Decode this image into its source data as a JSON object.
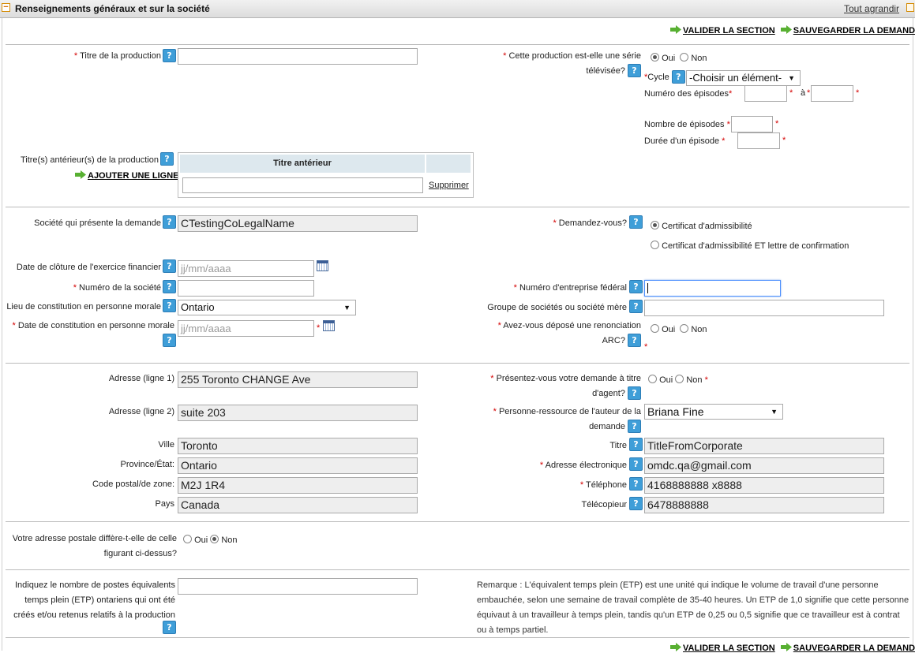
{
  "header": {
    "title": "Renseignements généraux et sur la société",
    "expand_all": "Tout agrandir",
    "collapse_symbol": "−"
  },
  "actions": {
    "validate": "VALIDER LA SECTION",
    "save": "SAUVEGARDER LA DEMANDE"
  },
  "help_glyph": "?",
  "required_mark": "*",
  "production": {
    "title_label": "Titre de la production",
    "title_value": "",
    "series_q_line1": "Cette production est-elle une série",
    "series_q_line2": "télévisée?",
    "yes": "Oui",
    "no": "Non",
    "cycle_label": "Cycle",
    "cycle_value": "-Choisir un élément-",
    "episodes_num_label": "Numéro des épisodes",
    "to": "à",
    "episodes_count_label": "Nombre de épisodes",
    "episode_duration_label": "Durée d'un épisode",
    "prior_titles_label": "Titre(s) antérieur(s) de la production",
    "add_line": "AJOUTER UNE LIGNE",
    "prior_table_header": "Titre antérieur",
    "delete": "Supprimer"
  },
  "company": {
    "applicant_label": "Société qui présente la demande",
    "applicant_value": "CTestingCoLegalName",
    "request_label": "Demandez-vous?",
    "request_opt1": "Certificat d'admissibilité",
    "request_opt2": "Certificat d'admissibilité ET lettre de confirmation",
    "fiscal_label": "Date de clôture de l'exercice financier",
    "date_placeholder": "jj/mm/aaaa",
    "number_label": "Numéro de la société",
    "federal_label": "Numéro d'entreprise fédéral",
    "incorp_place_label": "Lieu de constitution en personne morale",
    "incorp_place_value": "Ontario",
    "group_label": "Groupe de sociétés ou société mère",
    "incorp_date_label": "Date de constitution en personne morale",
    "waiver_line1": "Avez-vous déposé une renonciation",
    "waiver_line2": "ARC?"
  },
  "address": {
    "line1_label": "Adresse (ligne 1)",
    "line1_value": "255 Toronto CHANGE  Ave",
    "line2_label": "Adresse (ligne 2)",
    "line2_value": "suite 203",
    "city_label": "Ville",
    "city_value": "Toronto",
    "province_label": "Province/État:",
    "province_value": "Ontario",
    "postal_label": "Code postal/de zone:",
    "postal_value": "M2J 1R4",
    "country_label": "Pays",
    "country_value": "Canada",
    "agent_q_line1": "Présentez-vous votre demande à titre",
    "agent_q_line2": "d'agent?",
    "contact_line1": "Personne-ressource de l'auteur de la",
    "contact_line2": "demande",
    "contact_value": "Briana Fine",
    "title_label": "Titre",
    "title_value": "TitleFromCorporate",
    "email_label": "Adresse électronique",
    "email_value": "omdc.qa@gmail.com",
    "phone_label": "Téléphone",
    "phone_value": "4168888888 x8888",
    "fax_label": "Télécopieur",
    "fax_value": "6478888888"
  },
  "mailing": {
    "q_line1": "Votre adresse postale diffère-t-elle de celle",
    "q_line2": "figurant ci-dessus?"
  },
  "fte": {
    "label_line1": "Indiquez le nombre de postes équivalents",
    "label_line2": "temps plein (ETP) ontariens qui ont été",
    "label_line3": "créés et/ou retenus relatifs à la production",
    "value": "",
    "remark_line1": "Remarque : L'équivalent temps plein (ETP) est une unité qui indique le volume de travail d'une personne",
    "remark_line2": "embauchée, selon une semaine de travail complète de 35-40 heures. Un ETP de 1,0 signifie que cette personne",
    "remark_line3": "équivaut à un travailleur à temps plein, tandis qu'un ETP de 0,25 ou 0,5 signifie que ce travailleur est à contrat",
    "remark_line4": "ou à temps partiel."
  }
}
